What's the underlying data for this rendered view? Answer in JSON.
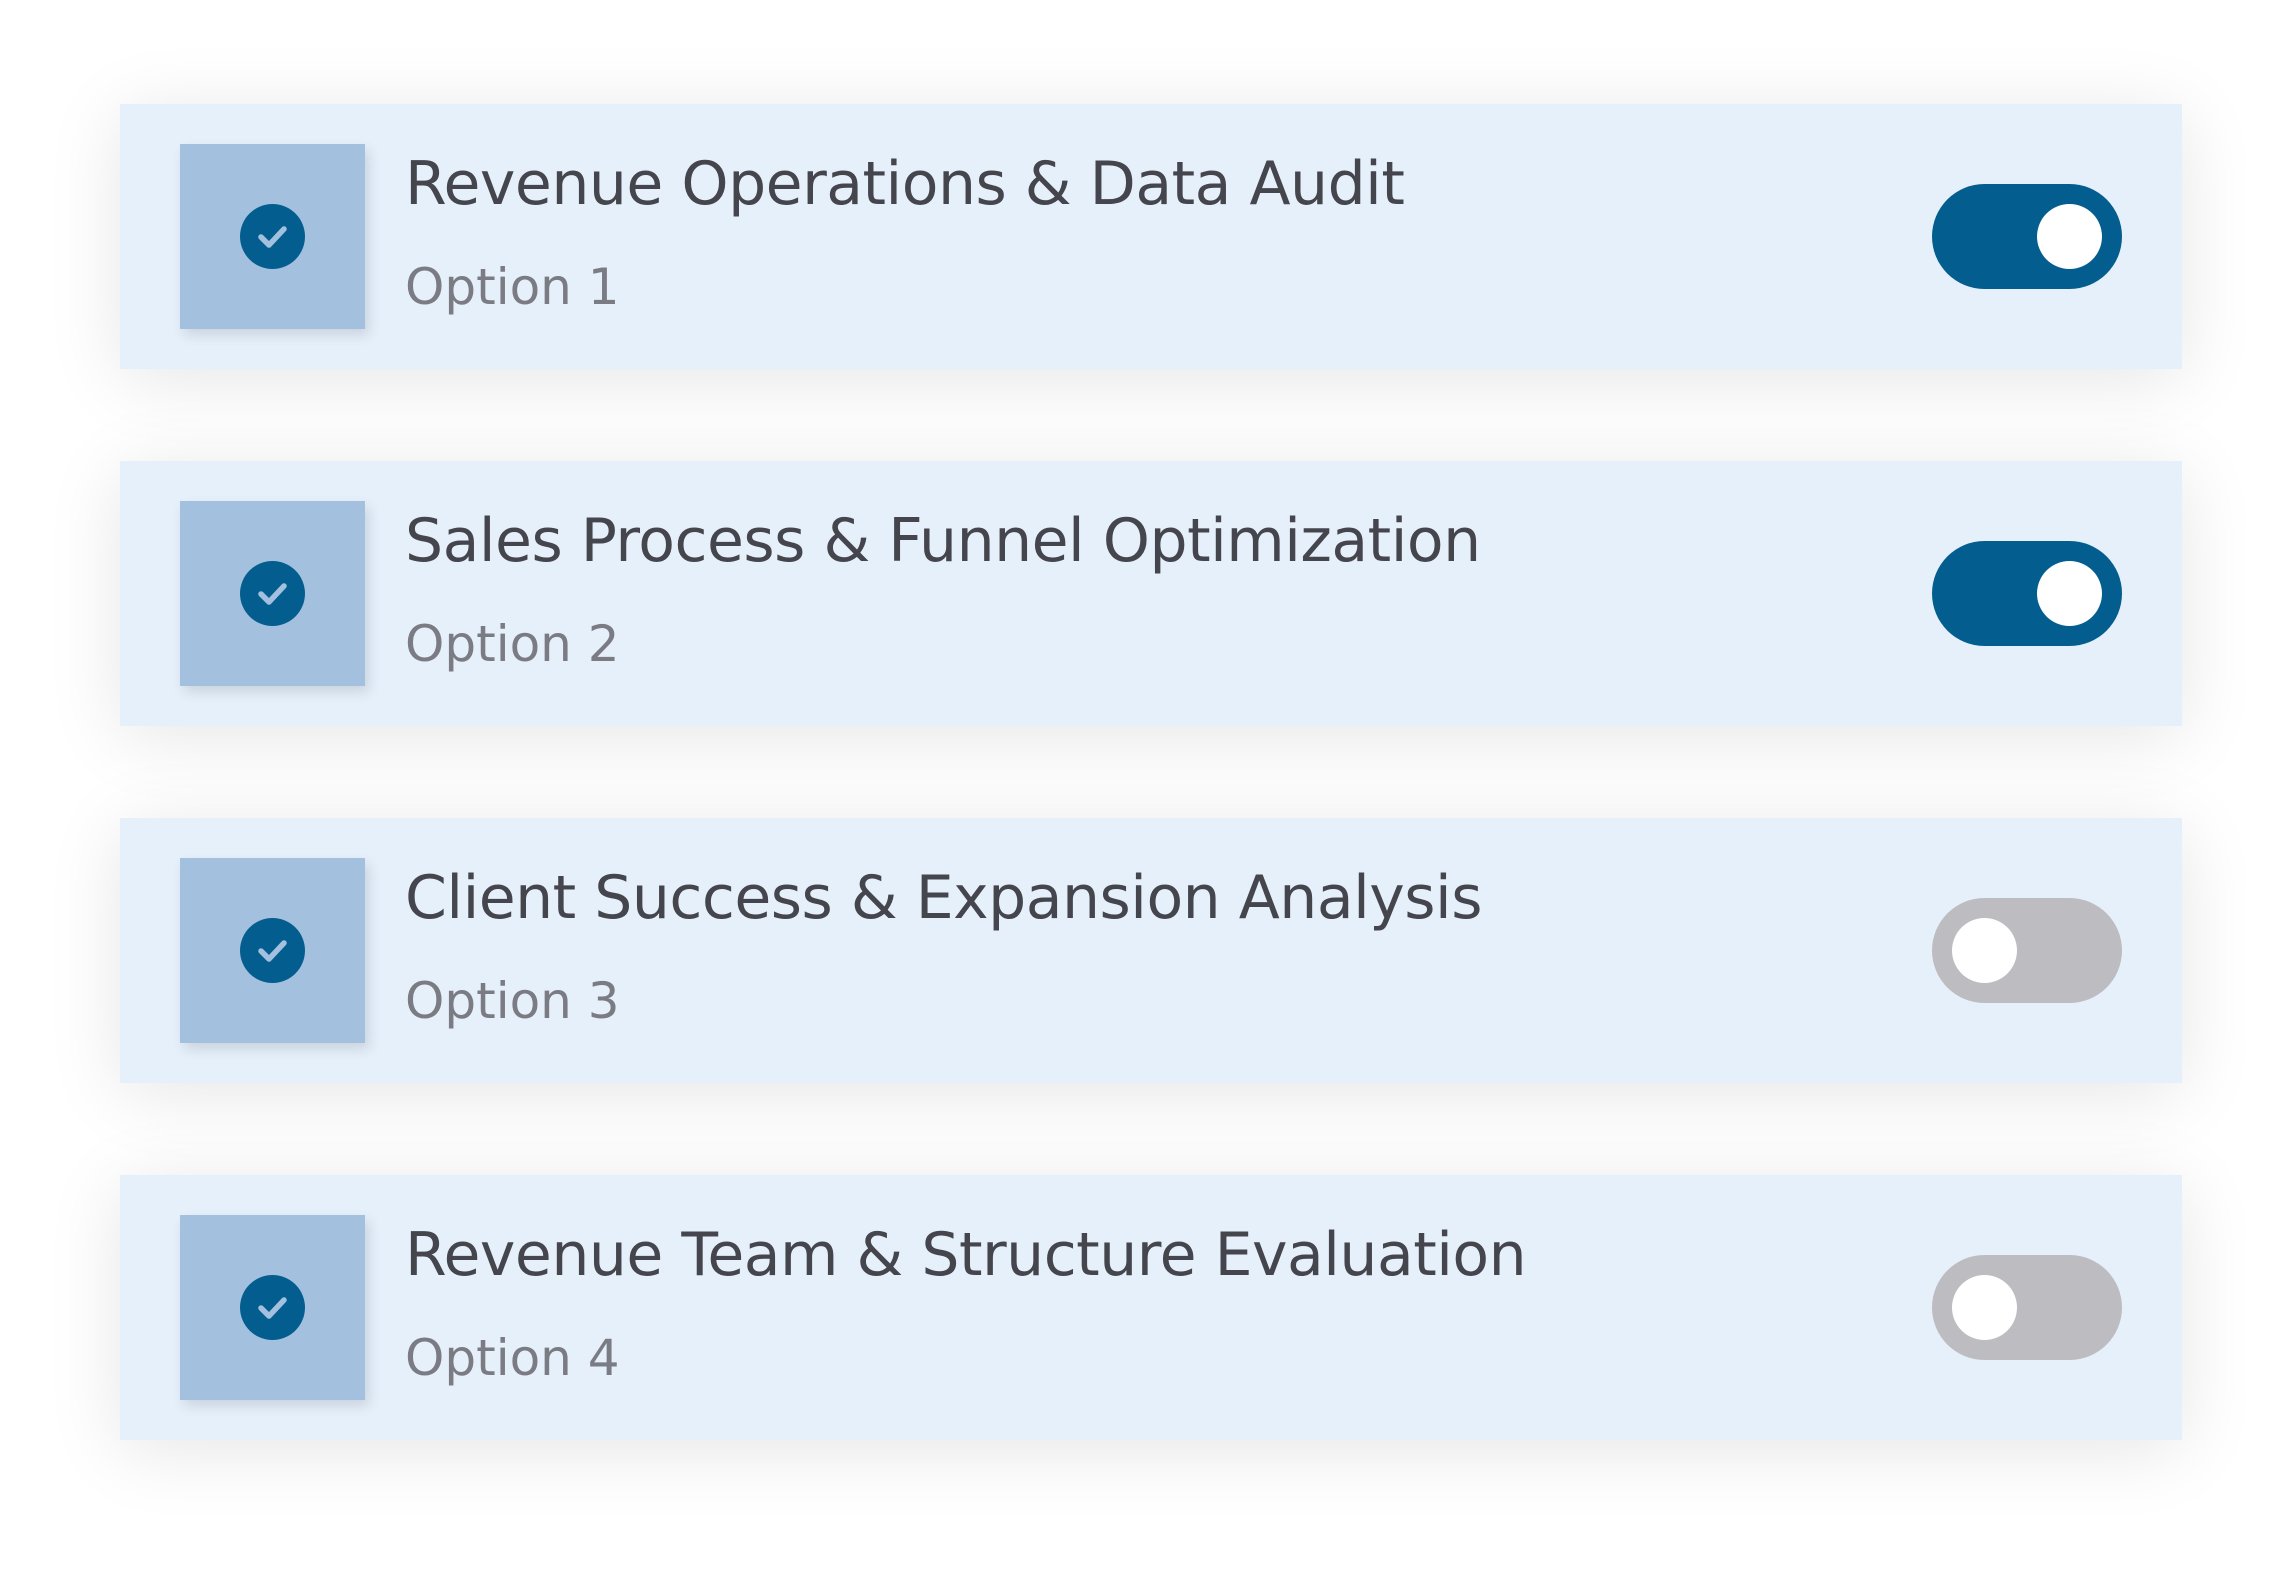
{
  "options": [
    {
      "title": "Revenue Operations & Data Audit",
      "subtitle": "Option 1",
      "enabled": true
    },
    {
      "title": "Sales Process & Funnel Optimization",
      "subtitle": "Option 2",
      "enabled": true
    },
    {
      "title": "Client Success & Expansion Analysis",
      "subtitle": "Option 3",
      "enabled": false
    },
    {
      "title": "Revenue Team & Structure Evaluation",
      "subtitle": "Option 4",
      "enabled": false
    }
  ],
  "icons": {
    "thumbnail": "check-circle-icon",
    "toggle": "toggle-switch"
  },
  "colors": {
    "accent": "#035e8f",
    "card_background": "#e6f0fb",
    "thumbnail_background": "#a3c1de",
    "toggle_off": "#bdbcc0",
    "title_text": "#45454d",
    "subtitle_text": "#7b7b83"
  }
}
